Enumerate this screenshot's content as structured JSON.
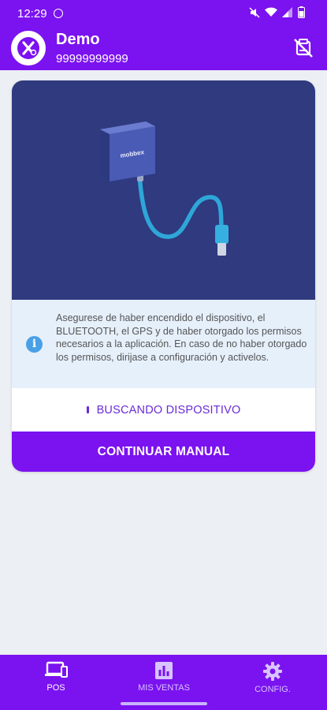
{
  "status_bar": {
    "time": "12:29"
  },
  "app_bar": {
    "title": "Demo",
    "subtitle": "99999999999"
  },
  "card": {
    "device_brand": "mobbex",
    "info_text": "Asegurese de haber encendido el dispositivo, el BLUETOOTH, el GPS y de haber otorgado los permisos necesarios a la aplicación. En caso de no haber otorgado los permisos, dirijase a configuración y activelos.",
    "search_status": "BUSCANDO DISPOSITIVO",
    "continue_label": "CONTINUAR MANUAL"
  },
  "bottom_nav": {
    "items": [
      {
        "label": "POS",
        "icon": "pos-devices-icon",
        "active": true
      },
      {
        "label": "MIS VENTAS",
        "icon": "bar-chart-icon",
        "active": false
      },
      {
        "label": "CONFIG.",
        "icon": "gear-icon",
        "active": false
      }
    ]
  },
  "colors": {
    "primary": "#7b12f0",
    "hero_bg": "#2f3a7f",
    "info_bg": "#e6f0fb",
    "info_icon": "#4aa0e6"
  }
}
